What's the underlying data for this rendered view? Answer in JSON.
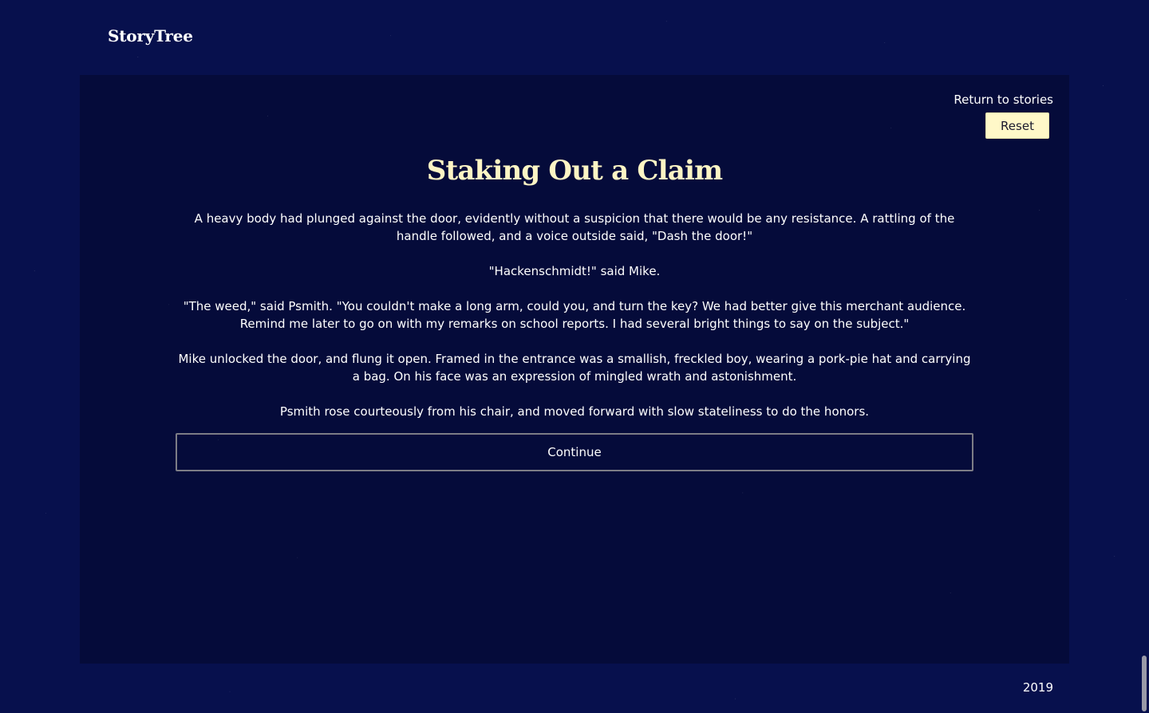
{
  "header": {
    "brand": "StoryTree"
  },
  "actions": {
    "return_label": "Return to stories",
    "reset_label": "Reset"
  },
  "story": {
    "title": "Staking Out a Claim",
    "paragraphs": [
      "A heavy body had plunged against the door, evidently without a suspicion that there would be any resistance. A rattling of the handle followed, and a voice outside said, \"Dash the door!\"",
      "\"Hackenschmidt!\" said Mike.",
      "\"The weed,\" said Psmith. \"You couldn't make a long arm, could you, and turn the key? We had better give this merchant audience. Remind me later to go on with my remarks on school reports. I had several bright things to say on the subject.\"",
      "Mike unlocked the door, and flung it open. Framed in the entrance was a smallish, freckled boy, wearing a pork-pie hat and carrying a bag. On his face was an expression of mingled wrath and astonishment.",
      "Psmith rose courteously from his chair, and moved forward with slow stateliness to do the honors."
    ],
    "continue_label": "Continue"
  },
  "footer": {
    "year": "2019"
  },
  "colors": {
    "page_background": "#07104d",
    "panel_background": "#050b3a",
    "title_color": "#fdf5c4",
    "reset_button_background": "#fff8c8"
  }
}
